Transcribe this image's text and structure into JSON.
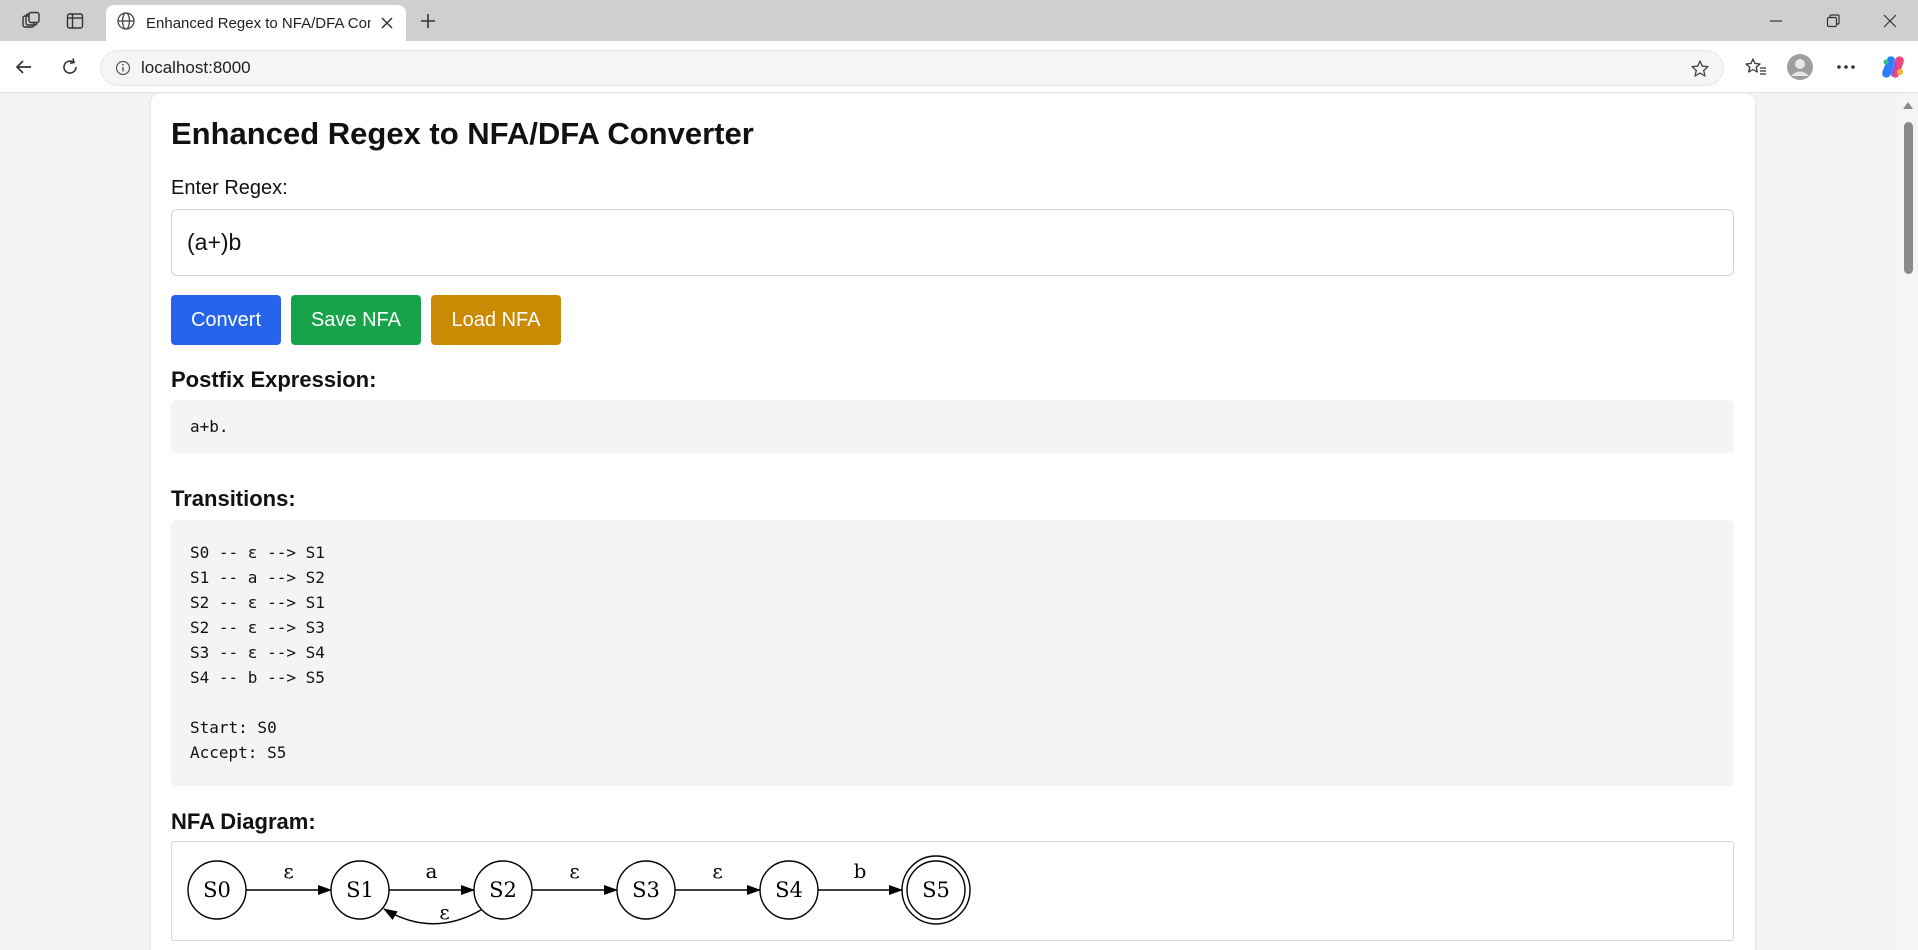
{
  "browser": {
    "tab_title": "Enhanced Regex to NFA/DFA Converter",
    "url": "localhost:8000"
  },
  "page": {
    "title": "Enhanced Regex to NFA/DFA Converter",
    "regex_label": "Enter Regex:",
    "regex_value": "(a+)b",
    "buttons": {
      "convert": "Convert",
      "save": "Save NFA",
      "load": "Load NFA"
    },
    "colors": {
      "convert": "#2563eb",
      "save": "#16a34a",
      "load": "#ca8a04"
    },
    "postfix": {
      "heading": "Postfix Expression:",
      "value": "a+b."
    },
    "transitions": {
      "heading": "Transitions:",
      "lines": [
        "S0 -- ε --> S1",
        "S1 -- a --> S2",
        "S2 -- ε --> S1",
        "S2 -- ε --> S3",
        "S3 -- ε --> S4",
        "S4 -- b --> S5"
      ],
      "start": "Start: S0",
      "accept": "Accept: S5"
    },
    "nfa_diagram": {
      "heading": "NFA Diagram:",
      "states": [
        "S0",
        "S1",
        "S2",
        "S3",
        "S4",
        "S5"
      ],
      "accept_state": "S5",
      "edges": [
        {
          "from": "S0",
          "to": "S1",
          "label": "ε"
        },
        {
          "from": "S1",
          "to": "S2",
          "label": "a"
        },
        {
          "from": "S2",
          "to": "S1",
          "label": "ε"
        },
        {
          "from": "S2",
          "to": "S3",
          "label": "ε"
        },
        {
          "from": "S3",
          "to": "S4",
          "label": "ε"
        },
        {
          "from": "S4",
          "to": "S5",
          "label": "b"
        }
      ]
    }
  }
}
